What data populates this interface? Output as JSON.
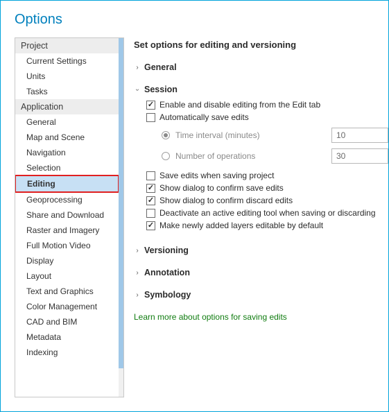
{
  "title": "Options",
  "sidebar": {
    "sections": [
      {
        "header": "Project",
        "items": [
          "Current Settings",
          "Units",
          "Tasks"
        ]
      },
      {
        "header": "Application",
        "items": [
          "General",
          "Map and Scene",
          "Navigation",
          "Selection",
          "Editing",
          "Geoprocessing",
          "Share and Download",
          "Raster and Imagery",
          "Full Motion Video",
          "Display",
          "Layout",
          "Text and Graphics",
          "Color Management",
          "CAD and BIM",
          "Metadata",
          "Indexing"
        ]
      }
    ],
    "selected": "Editing"
  },
  "main": {
    "title": "Set options for editing and versioning",
    "groups": {
      "general": {
        "label": "General",
        "expanded": false
      },
      "session": {
        "label": "Session",
        "expanded": true,
        "enableEdit": {
          "label": "Enable and disable editing from the Edit tab",
          "checked": true
        },
        "autoSave": {
          "label": "Automatically save edits",
          "checked": false
        },
        "timeInterval": {
          "label": "Time interval (minutes)",
          "value": "10",
          "selected": true
        },
        "numOps": {
          "label": "Number of operations",
          "value": "30",
          "selected": false
        },
        "saveOnProjectSave": {
          "label": "Save edits when saving project",
          "checked": false
        },
        "confirmSave": {
          "label": "Show dialog to confirm save edits",
          "checked": true
        },
        "confirmDiscard": {
          "label": "Show dialog to confirm discard edits",
          "checked": true
        },
        "deactivateTool": {
          "label": "Deactivate an active editing tool when saving or discarding",
          "checked": false
        },
        "newLayersEditable": {
          "label": "Make newly added layers editable by default",
          "checked": true
        }
      },
      "versioning": {
        "label": "Versioning",
        "expanded": false
      },
      "annotation": {
        "label": "Annotation",
        "expanded": false
      },
      "symbology": {
        "label": "Symbology",
        "expanded": false
      }
    },
    "learnMore": "Learn more about options for saving edits"
  }
}
